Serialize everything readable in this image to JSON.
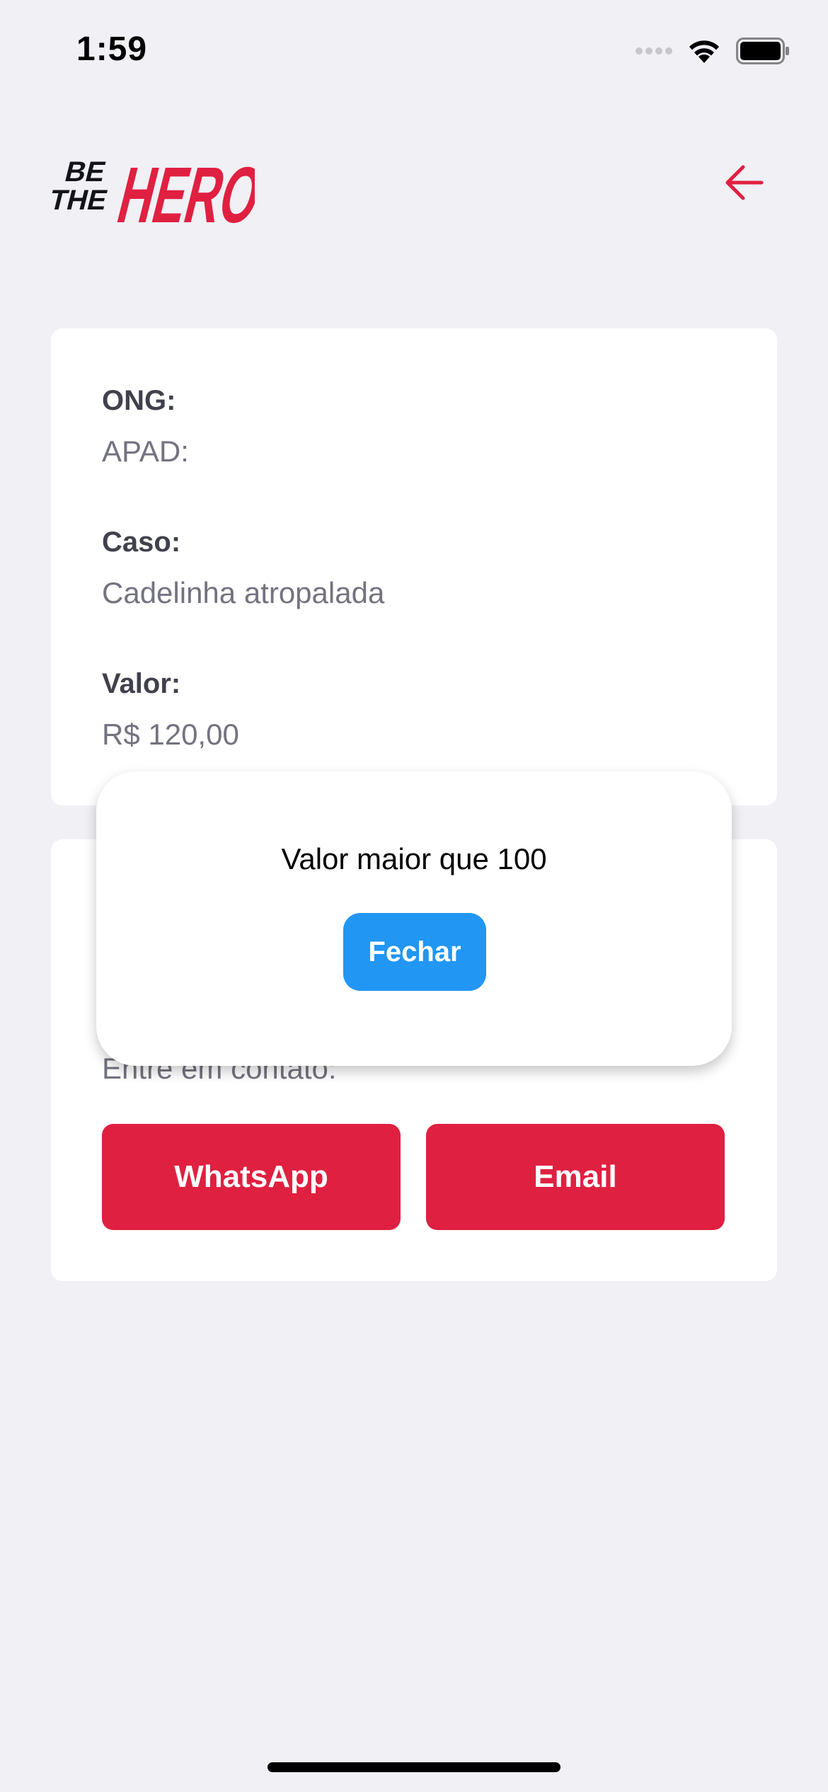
{
  "status_bar": {
    "time": "1:59",
    "icons": [
      "cellular-signal-icon",
      "wifi-icon",
      "battery-icon"
    ]
  },
  "header": {
    "logo_text": "BE THE HERO",
    "back_icon": "arrow-left-icon"
  },
  "incident": {
    "fields": [
      {
        "label": "ONG:",
        "value": "APAD:"
      },
      {
        "label": "Caso:",
        "value": "Cadelinha atropalada"
      },
      {
        "label": "Valor:",
        "value": "R$ 120,00"
      }
    ]
  },
  "contact": {
    "subtitle": "Entre em contato:",
    "whatsapp_label": "WhatsApp",
    "email_label": "Email"
  },
  "modal": {
    "message": "Valor maior que 100",
    "close_label": "Fechar"
  },
  "colors": {
    "background": "#f0f0f5",
    "brand_red": "#e02041",
    "modal_button_blue": "#2196f3",
    "label_dark": "#41414d",
    "value_gray": "#737380"
  }
}
